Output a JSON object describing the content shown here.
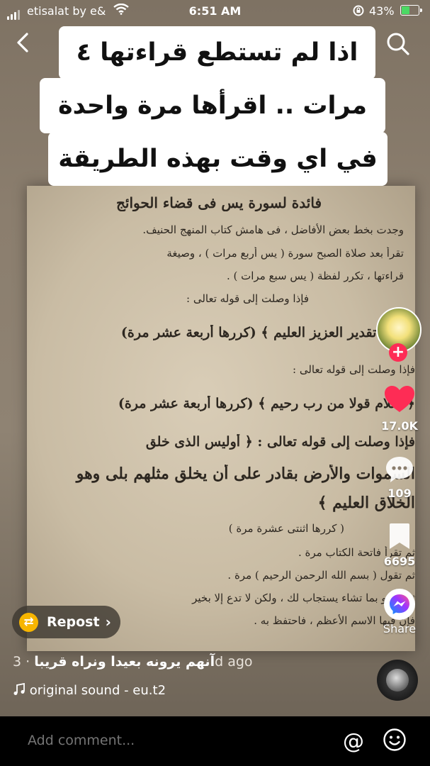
{
  "status": {
    "carrier": "etisalat by e&",
    "time": "6:51 AM",
    "battery": "43%",
    "battery_level": 0.43
  },
  "caption_lines": [
    "اذا لم تستطع قراءتها ٤",
    "مرات .. اقرأها مرة واحدة",
    "في اي وقت بهذه الطريقة"
  ],
  "paper": {
    "title": "فائدة لسورة يس فى قضاء الحوائج",
    "lines": [
      "وجدت بخط بعض الأفاضل ، فى هامش كتاب المنهج الحنيف.",
      "تقرأ بعد صلاة الصبح سورة ( يس أربع مرات ) ، وصيغة",
      "قراءتها ، تكرر لفظة ( يس سبع مرات ) .",
      "فإذا وصلت إلى قوله تعالى :",
      "﴿ ذلك تقدير العزيز العليم ﴾ (كررها أربعة عشر مرة)",
      "فإذا وصلت إلى قوله تعالى :",
      "﴿ سلام قولا من رب رحيم ﴾ (كررها أربعة عشر مرة)",
      "فإذا وصلت إلى قوله تعالى : ﴿ أوليس الذى خلق",
      "السموات والأرض بقادر على أن يخلق مثلهم بلى وهو",
      "الخلاق العليم ﴾",
      "( كررها اثنتى عشرة مرة )",
      "ثم تقرأ فاتحة الكتاب مرة .",
      "ثم تقول ( بسم الله الرحمن الرحيم ) مرة .",
      "ثم تدعو بما تشاء يستجاب لك ، ولكن لا تدع إلا بخير",
      "فإن فيها الاسم الأعظم ، فاحتفظ به ."
    ]
  },
  "actions": {
    "likes": "17.0K",
    "comments": "109",
    "saves": "6695",
    "share_label": "Share"
  },
  "repost_label": "Repost",
  "description": {
    "text": "آنهم يرونه بعيدا ونراه قريبا",
    "time": "· 3d ago"
  },
  "sound": "original sound - eu.t2",
  "comment": {
    "placeholder": "Add comment..."
  },
  "colors": {
    "like": "#fe2c55",
    "repost": "#f7b500",
    "messenger_start": "#0099ff",
    "messenger_end": "#a033ff"
  },
  "icons": {
    "back": "chevron-left-icon",
    "search": "search-icon",
    "like": "heart-icon",
    "comment": "comment-bubble-icon",
    "save": "bookmark-icon",
    "share": "messenger-icon",
    "mention": "at-icon",
    "emoji": "emoji-icon",
    "music": "music-note-icon"
  }
}
